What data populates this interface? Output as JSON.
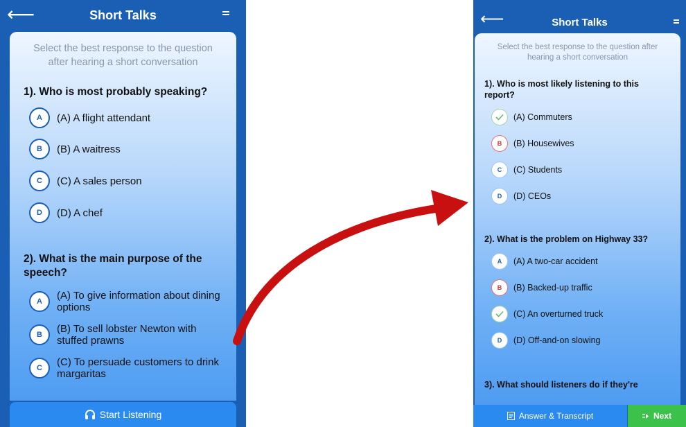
{
  "left_screen": {
    "title": "Short Talks",
    "instruction": "Select the best response to the question after hearing a short conversation",
    "questions": [
      {
        "text": "1). Who is most probably speaking?",
        "options": [
          {
            "letter": "A",
            "text": "(A) A flight attendant"
          },
          {
            "letter": "B",
            "text": "(B) A waitress"
          },
          {
            "letter": "C",
            "text": "(C) A sales person"
          },
          {
            "letter": "D",
            "text": "(D) A chef"
          }
        ]
      },
      {
        "text": "2). What is the main purpose of the speech?",
        "options": [
          {
            "letter": "A",
            "text": "(A) To give information about dining options"
          },
          {
            "letter": "B",
            "text": "(B) To sell lobster Newton with stuffed prawns"
          },
          {
            "letter": "C",
            "text": "(C) To persuade customers to drink margaritas"
          }
        ]
      }
    ],
    "start_button": "Start Listening"
  },
  "right_screen": {
    "title": "Short Talks",
    "instruction": "Select the best response to the question after hearing a short conversation",
    "questions": [
      {
        "text": "1). Who is most likely listening to this report?",
        "options": [
          {
            "letter": "",
            "state": "correct",
            "text": "(A) Commuters"
          },
          {
            "letter": "B",
            "state": "wrong",
            "text": "(B) Housewives"
          },
          {
            "letter": "C",
            "state": "default",
            "text": "(C) Students"
          },
          {
            "letter": "D",
            "state": "default",
            "text": "(D) CEOs"
          }
        ]
      },
      {
        "text": "2). What is the problem on Highway 33?",
        "options": [
          {
            "letter": "A",
            "state": "default",
            "text": "(A) A two-car accident"
          },
          {
            "letter": "B",
            "state": "wrong",
            "text": "(B) Backed-up traffic"
          },
          {
            "letter": "",
            "state": "correct",
            "text": "(C) An overturned truck"
          },
          {
            "letter": "D",
            "state": "default",
            "text": "(D) Off-and-on slowing"
          }
        ]
      },
      {
        "text": "3). What should listeners do if they're"
      }
    ],
    "answer_button": "Answer & Transcript",
    "next_button": "Next"
  },
  "colors": {
    "primary": "#1a5fb4",
    "button_blue": "#2b8af0",
    "next_green": "#3cc24b",
    "arrow_red": "#c81010"
  },
  "icons": {
    "back": "arrow-left-icon",
    "menu": "menu-icon",
    "headphones": "headphones-icon",
    "transcript": "document-icon",
    "next": "next-icon",
    "correct": "check-icon"
  }
}
